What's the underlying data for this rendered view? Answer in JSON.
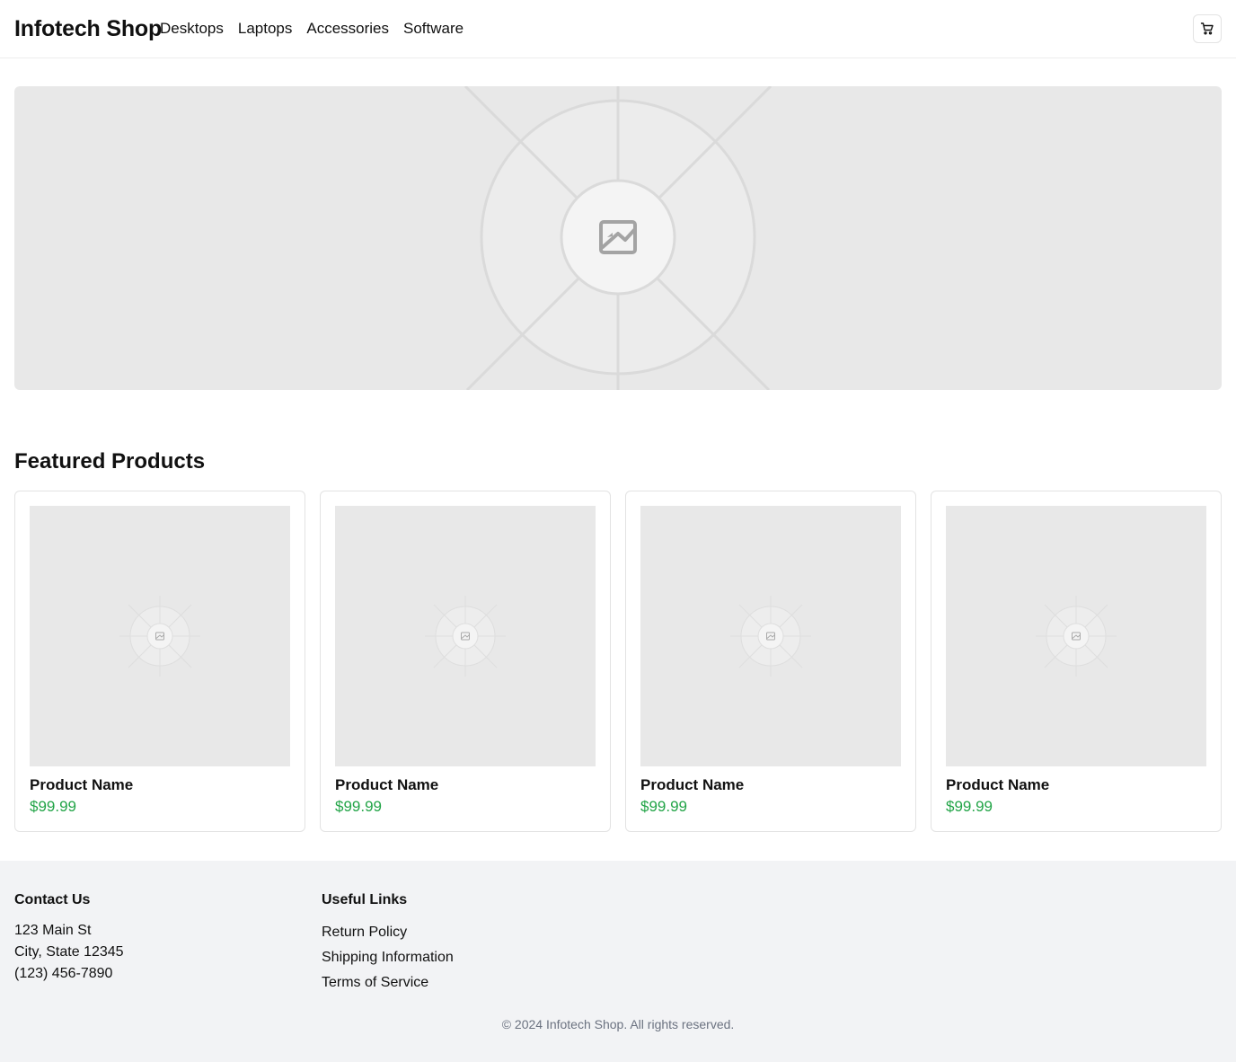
{
  "header": {
    "brand": "Infotech Shop",
    "nav": [
      "Desktops",
      "Laptops",
      "Accessories",
      "Software"
    ],
    "cart_icon": "shopping-cart-icon"
  },
  "hero": {
    "image_icon": "image-placeholder-icon"
  },
  "featured": {
    "title": "Featured Products",
    "products": [
      {
        "name": "Product Name",
        "price": "$99.99"
      },
      {
        "name": "Product Name",
        "price": "$99.99"
      },
      {
        "name": "Product Name",
        "price": "$99.99"
      },
      {
        "name": "Product Name",
        "price": "$99.99"
      }
    ]
  },
  "footer": {
    "contact": {
      "title": "Contact Us",
      "lines": [
        "123 Main St",
        "City, State 12345",
        "(123) 456-7890"
      ]
    },
    "links": {
      "title": "Useful Links",
      "items": [
        "Return Policy",
        "Shipping Information",
        "Terms of Service"
      ]
    },
    "copyright": "© 2024 Infotech Shop. All rights reserved."
  },
  "colors": {
    "price": "#22a447",
    "placeholder_bg": "#e8e8e8",
    "footer_bg": "#f2f3f5"
  }
}
